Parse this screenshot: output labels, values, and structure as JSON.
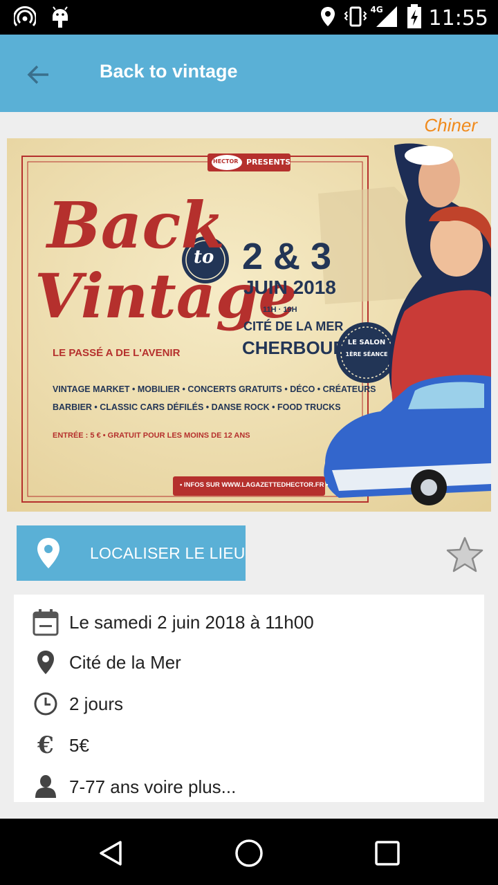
{
  "status_bar": {
    "time": "11:55",
    "network": "4G"
  },
  "app_bar": {
    "title": "Back to vintage"
  },
  "category": "Chiner",
  "poster": {
    "presenter": "HECTOR",
    "presents": "PRESENTS",
    "title_line1": "Back",
    "title_to": "to",
    "title_line2": "Vintage",
    "tagline": "LE PASSÉ A DE L'AVENIR",
    "dates": "2 & 3",
    "month": "JUIN 2018",
    "hours": "11H · 19H",
    "venue": "CITÉ DE LA MER",
    "city": "CHERBOURG",
    "seal_line1": "LE SALON",
    "seal_line2": "1ÈRE SÉANCE",
    "features_line1": "VINTAGE MARKET • MOBILIER • CONCERTS GRATUITS • DÉCO • CRÉATEURS",
    "features_line2": "BARBIER • CLASSIC CARS DÉFILÉS • DANSE ROCK • FOOD TRUCKS",
    "price_line": "ENTRÉE : 5 € • GRATUIT POUR LES MOINS DE 12 ANS",
    "info_line": "• INFOS SUR WWW.LAGAZETTEDHECTOR.FR •"
  },
  "actions": {
    "locate_label": "LOCALISER LE LIEU"
  },
  "details": {
    "date": "Le samedi 2 juin 2018 à 11h00",
    "place": "Cité de la Mer",
    "duration": "2 jours",
    "price": "5€",
    "age": "7-77 ans voire plus..."
  }
}
